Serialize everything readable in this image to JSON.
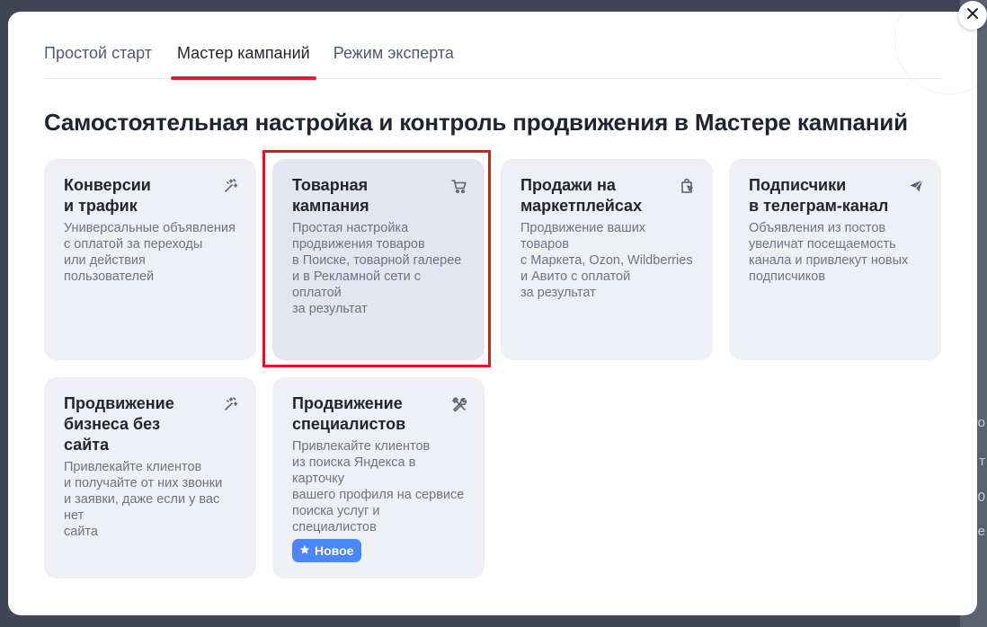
{
  "tabs": [
    {
      "label": "Простой старт"
    },
    {
      "label": "Мастер кампаний"
    },
    {
      "label": "Режим эксперта"
    }
  ],
  "heading": "Самостоятельная настройка и контроль продвижения в Мастере кампаний",
  "cards": [
    {
      "title": "Конверсии\nи трафик",
      "desc": "Универсальные объявления\nс оплатой за переходы\nили действия пользователей",
      "icon": "sparkle-magic-icon"
    },
    {
      "title": "Товарная\nкампания",
      "desc": "Простая настройка\nпродвижения товаров\nв Поиске, товарной галерее\nи в Рекламной сети с оплатой\nза результат",
      "icon": "shopping-cart-icon"
    },
    {
      "title": "Продажи на\nмаркетплейсах",
      "desc": "Продвижение ваших товаров\nс Маркета, Ozon, Wildberries\nи Авито с оплатой\nза результат",
      "icon": "shopping-bag-cursor-icon"
    },
    {
      "title": "Подписчики\nв телеграм-канал",
      "desc": "Объявления из постов\nувеличат посещаемость\nканала и привлекут новых\nподписчиков",
      "icon": "send-plane-icon"
    },
    {
      "title": "Продвижение\nбизнеса без сайта",
      "desc": "Привлекайте клиентов\nи получайте от них звонки\nи заявки, даже если у вас нет\nсайта",
      "icon": "sparkle-magic-icon"
    },
    {
      "title": "Продвижение\nспециалистов",
      "desc": "Привлекайте клиентов\nиз поиска Яндекса в карточку\nвашего профиля на сервисе\nпоиска услуг и специалистов",
      "icon": "tools-icon",
      "badge": "Новое"
    }
  ],
  "colors": {
    "accent_red": "#e2202b",
    "badge_blue": "#4a86f7",
    "card_bg": "#eef0f5"
  }
}
